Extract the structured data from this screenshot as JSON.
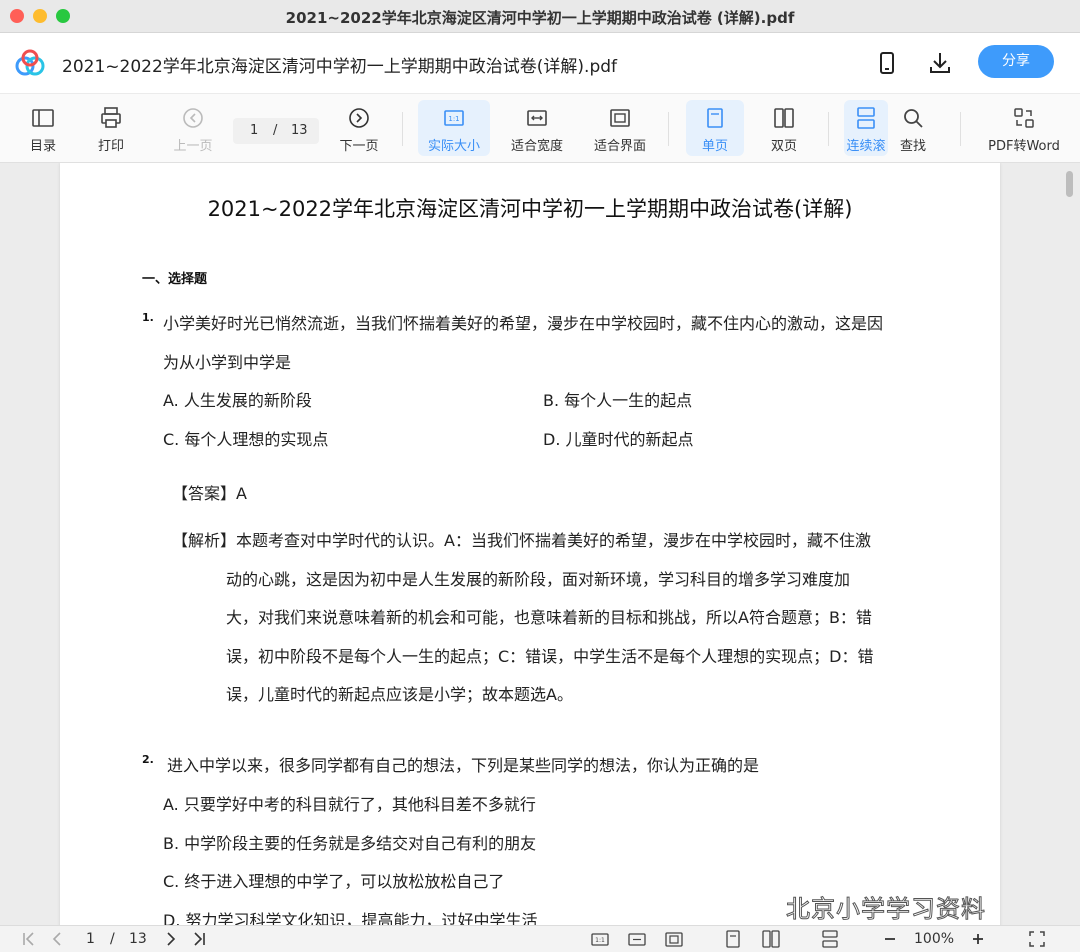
{
  "window": {
    "title": "2021~2022学年北京海淀区清河中学初一上学期期中政治试卷 (详解).pdf"
  },
  "header": {
    "doc_title": "2021~2022学年北京海淀区清河中学初一上学期期中政治试卷(详解).pdf",
    "share_label": "分享",
    "icons": [
      "app-logo",
      "phone-icon",
      "download-icon"
    ]
  },
  "toolbar": {
    "toc": "目录",
    "print": "打印",
    "prev_page": "上一页",
    "current_page": "1",
    "page_sep": "/",
    "total_pages": "13",
    "next_page": "下一页",
    "actual_size": "实际大小",
    "fit_width": "适合宽度",
    "fit_page": "适合界面",
    "single_page": "单页",
    "double_page": "双页",
    "continuous": "连续滚",
    "find": "查找",
    "pdf_to_word": "PDF转Word"
  },
  "document": {
    "title": "2021~2022学年北京海淀区清河中学初一上学期期中政治试卷(详解)",
    "section": "一、选择题",
    "q1": {
      "num": "1.",
      "stem_1": "小学美好时光已悄然流逝，当我们怀揣着美好的希望，漫步在中学校园时，藏不住内心的激动，这是因",
      "stem_2": "为从小学到中学是",
      "opt_a": "A. 人生发展的新阶段",
      "opt_b": "B. 每个人一生的起点",
      "opt_c": "C. 每个人理想的实现点",
      "opt_d": "D. 儿童时代的新起点",
      "answer": "【答案】A",
      "analysis_1": "【解析】本题考查对中学时代的认识。A：当我们怀揣着美好的希望，漫步在中学校园时，藏不住激",
      "analysis_2": "动的心跳，这是因为初中是人生发展的新阶段，面对新环境，学习科目的增多学习难度加",
      "analysis_3": "大，对我们来说意味着新的机会和可能，也意味着新的目标和挑战，所以A符合题意；B：错",
      "analysis_4": "误，初中阶段不是每个人一生的起点；C：错误，中学生活不是每个人理想的实现点；D：错",
      "analysis_5": "误，儿童时代的新起点应该是小学；故本题选A。"
    },
    "q2": {
      "num": "2.",
      "stem": "进入中学以来，很多同学都有自己的想法，下列是某些同学的想法，你认为正确的是",
      "opt_a": "A. 只要学好中考的科目就行了，其他科目差不多就行",
      "opt_b": "B. 中学阶段主要的任务就是多结交对自己有利的朋友",
      "opt_c": "C. 终于进入理想的中学了，可以放松放松自己了",
      "opt_d": "D. 努力学习科学文化知识，提高能力，过好中学生活"
    }
  },
  "statusbar": {
    "current_page": "1",
    "page_sep": "/",
    "total_pages": "13",
    "zoom": "100%"
  },
  "watermark": "北京小学学习资料",
  "colors": {
    "accent": "#3e9bfb",
    "active_bg": "#e6f1fd"
  }
}
